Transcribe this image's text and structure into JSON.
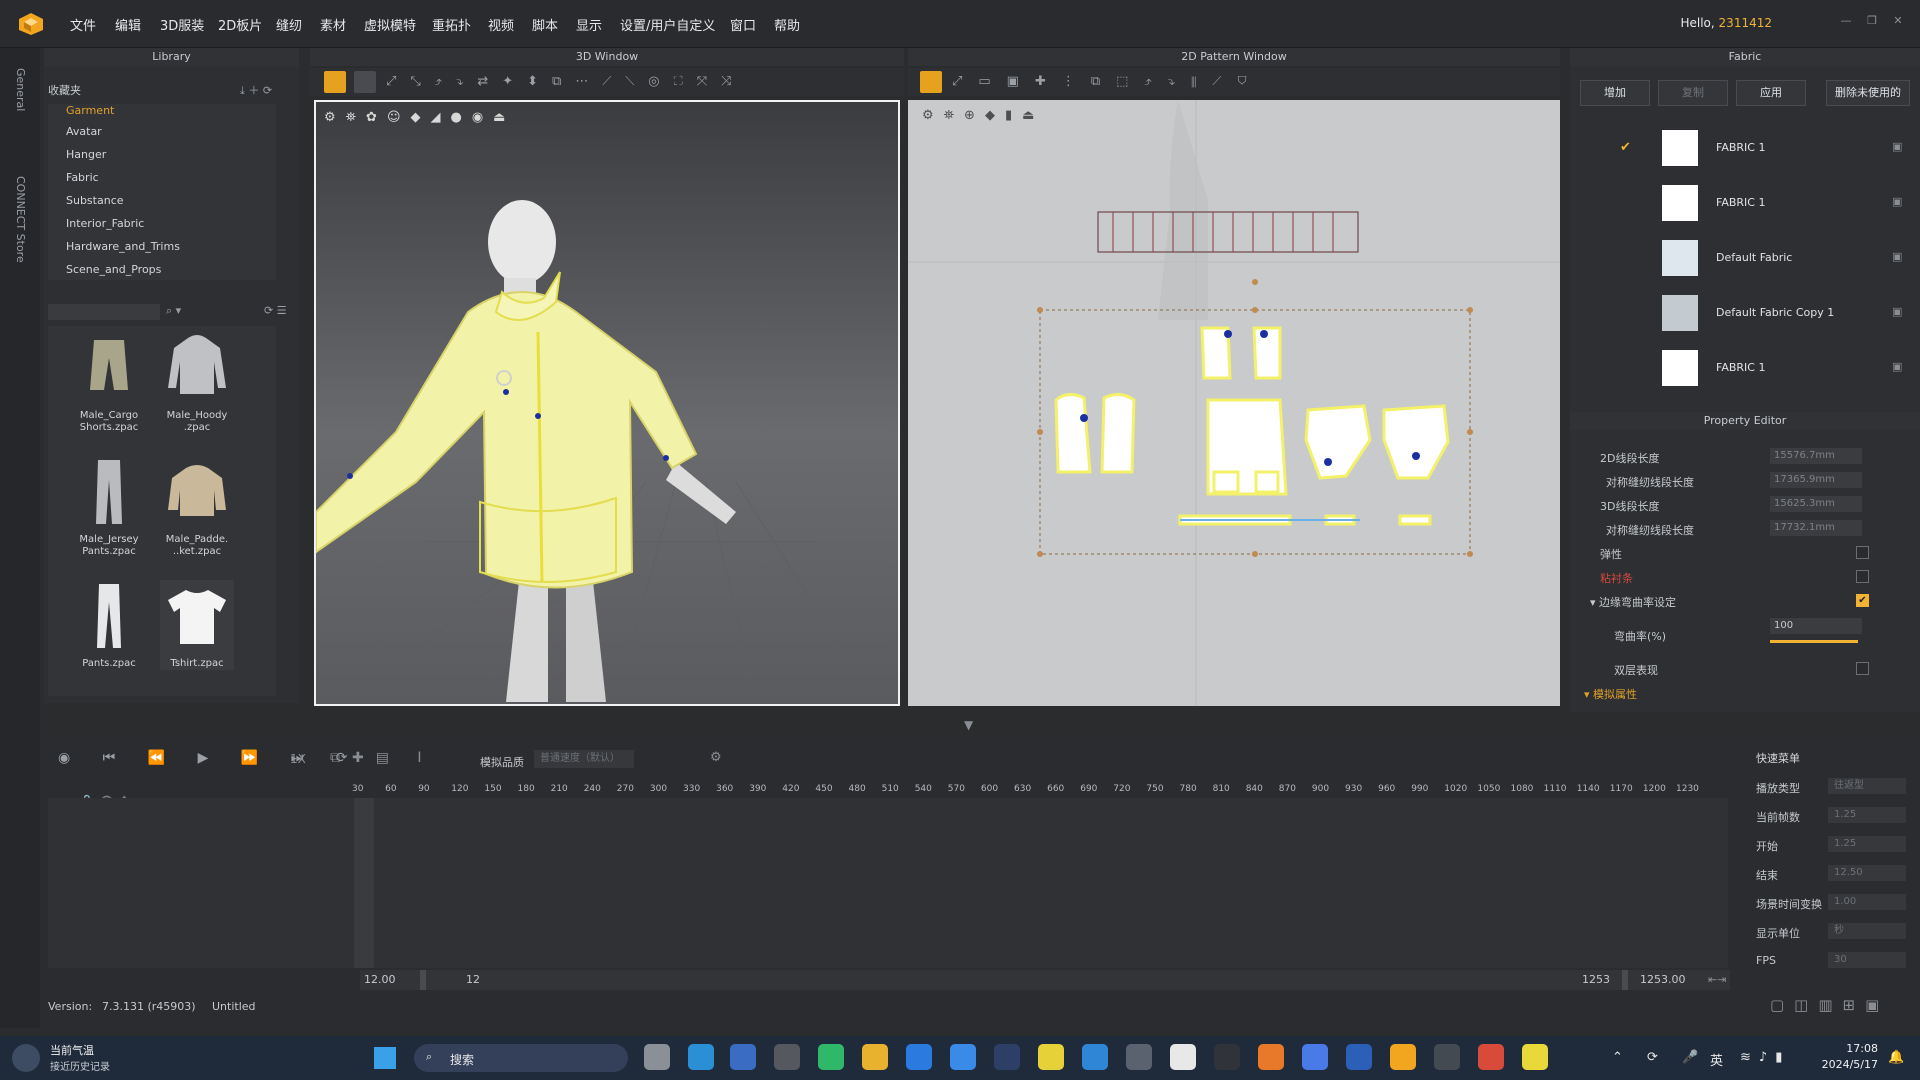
{
  "menubar": {
    "items": [
      "文件",
      "编辑",
      "3D服装",
      "2D板片",
      "缝纫",
      "素材",
      "虚拟模特",
      "重拓扑",
      "视频",
      "脚本",
      "显示",
      "设置/用户自定义",
      "窗口",
      "帮助"
    ],
    "greeting": "Hello,",
    "username": "2311412"
  },
  "sidetabs": [
    "General",
    "CONNECT Store"
  ],
  "library": {
    "title": "Library",
    "section": "收藏夹",
    "categories": [
      "Garment",
      "Avatar",
      "Hanger",
      "Fabric",
      "Substance",
      "Interior_Fabric",
      "Hardware_and_Trims",
      "Scene_and_Props"
    ],
    "items": [
      {
        "label1": "Male_Cargo",
        "label2": "Shorts.zpac"
      },
      {
        "label1": "Male_Hoody",
        "label2": ".zpac"
      },
      {
        "label1": "Male_Jersey",
        "label2": "Pants.zpac"
      },
      {
        "label1": "Male_Padde.",
        "label2": "..ket.zpac"
      },
      {
        "label1": "Pants.zpac",
        "label2": ""
      },
      {
        "label1": "Tshirt.zpac",
        "label2": ""
      }
    ]
  },
  "window3d": {
    "title": "3D Window"
  },
  "window2d": {
    "title": "2D Pattern Window"
  },
  "fabric": {
    "title": "Fabric",
    "buttons": [
      "增加",
      "复制",
      "应用",
      "删除未使用的"
    ],
    "items": [
      {
        "name": "FABRIC 1",
        "checked": true,
        "color": "#ffffff"
      },
      {
        "name": "FABRIC 1",
        "checked": false,
        "color": "#ffffff"
      },
      {
        "name": "Default Fabric",
        "checked": false,
        "color": "#dfe7ee"
      },
      {
        "name": "Default Fabric Copy 1",
        "checked": false,
        "color": "#c3cbd1"
      },
      {
        "name": "FABRIC 1",
        "checked": false,
        "color": "#ffffff"
      }
    ]
  },
  "propeditor": {
    "title": "Property Editor",
    "rows": [
      {
        "label": "2D线段长度",
        "value": "15576.7mm"
      },
      {
        "label": "对称缝纫线段长度",
        "value": "17365.9mm"
      },
      {
        "label": "3D线段长度",
        "value": "15625.3mm"
      },
      {
        "label": "对称缝纫线段长度",
        "value": "17732.1mm"
      }
    ],
    "elastic": "弹性",
    "binding": "粘衬条",
    "curvature_group": "边缘弯曲率设定",
    "curvature_label": "弯曲率(%)",
    "curvature_value": "100",
    "double_side": "双层表现",
    "sim_props": "模拟属性"
  },
  "timeline": {
    "mode_label": "模拟品质",
    "mode_value": "普通速度（默认）",
    "speed": "1X",
    "ticks": [
      "30",
      "60",
      "90",
      "120",
      "150",
      "180",
      "210",
      "240",
      "270",
      "300",
      "330",
      "360",
      "390",
      "420",
      "450",
      "480",
      "510",
      "540",
      "570",
      "600",
      "630",
      "660",
      "690",
      "720",
      "750",
      "780",
      "810",
      "840",
      "870",
      "900",
      "930",
      "960",
      "990",
      "1020",
      "1050",
      "1080",
      "1110",
      "1140",
      "1170",
      "1200",
      "1230"
    ],
    "start_time": "12.00",
    "start_frame": "12",
    "end_frame": "1253",
    "end_time": "1253.00"
  },
  "quickmenu": {
    "title": "快速菜单",
    "rows": [
      {
        "label": "播放类型",
        "value": "往返型"
      },
      {
        "label": "当前帧数",
        "value": "1.25"
      },
      {
        "label": "开始",
        "value": "1.25"
      },
      {
        "label": "结束",
        "value": "12.50"
      },
      {
        "label": "场景时间变换",
        "value": "1.00"
      },
      {
        "label": "显示单位",
        "value": "秒"
      },
      {
        "label": "FPS",
        "value": "30"
      }
    ]
  },
  "status": {
    "version_label": "Version:",
    "version": "7.3.131 (r45903)",
    "file": "Untitled"
  },
  "taskbar": {
    "weather_title": "当前气温",
    "weather_sub": "接近历史记录",
    "search": "搜索",
    "ime": "英",
    "time": "17:08",
    "date": "2024/5/17"
  },
  "colors": {
    "accent": "#f2b233",
    "garment": "#f2f2a8",
    "pattern_outline": "#f3f06a",
    "pattern_blue": "#6ab0e8"
  }
}
